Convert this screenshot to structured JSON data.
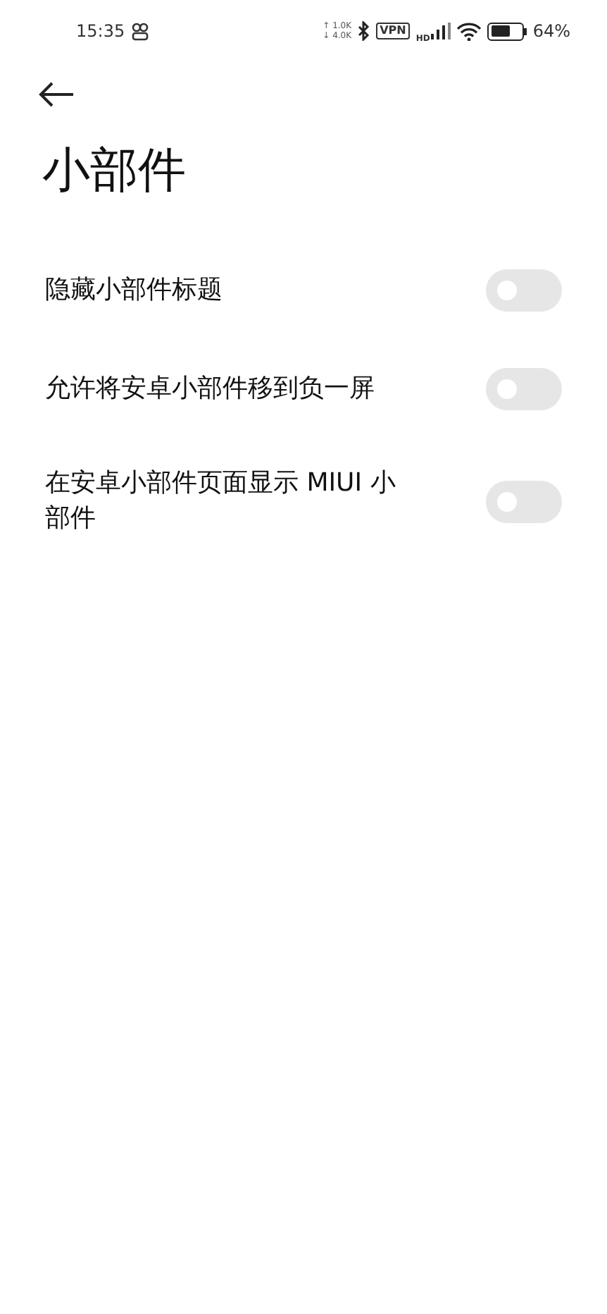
{
  "status_bar": {
    "time": "15:35",
    "upload_speed": "↑ 1.0K",
    "download_speed": "↓ 4.0K",
    "vpn": "VPN",
    "network": "HD",
    "battery": "64%"
  },
  "title": "小部件",
  "settings": [
    {
      "label": "隐藏小部件标题",
      "on": false
    },
    {
      "label": "允许将安卓小部件移到负一屏",
      "on": false
    },
    {
      "label": "在安卓小部件页面显示 MIUI 小部件",
      "on": false
    }
  ]
}
